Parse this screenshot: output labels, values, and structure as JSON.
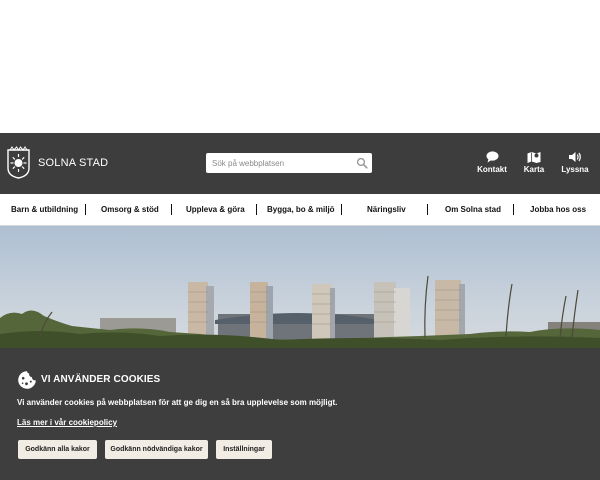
{
  "header": {
    "site_name": "SOLNA STAD",
    "search_placeholder": "Sök på webbplatsen",
    "utilities": [
      {
        "label": "Kontakt",
        "icon": "chat-icon"
      },
      {
        "label": "Karta",
        "icon": "map-icon"
      },
      {
        "label": "Lyssna",
        "icon": "speaker-icon"
      }
    ]
  },
  "nav": {
    "items": [
      "Barn & utbildning",
      "Omsorg & stöd",
      "Uppleva & göra",
      "Bygga, bo & miljö",
      "Näringsliv",
      "Om Solna stad",
      "Jobba hos oss"
    ]
  },
  "cookie_banner": {
    "title": "VI ANVÄNDER COOKIES",
    "text": "Vi använder cookies på webbplatsen för att ge dig en så bra upplevelse som möjligt.",
    "link": "Läs mer i vår cookiepolicy",
    "buttons": {
      "accept_all": "Godkänn alla kakor",
      "accept_necessary": "Godkänn nödvändiga kakor",
      "settings": "Inställningar"
    }
  },
  "colors": {
    "header_bg": "#3d3d3d",
    "banner_bg": "#3e3e3e",
    "button_bg": "#f2ede4"
  }
}
